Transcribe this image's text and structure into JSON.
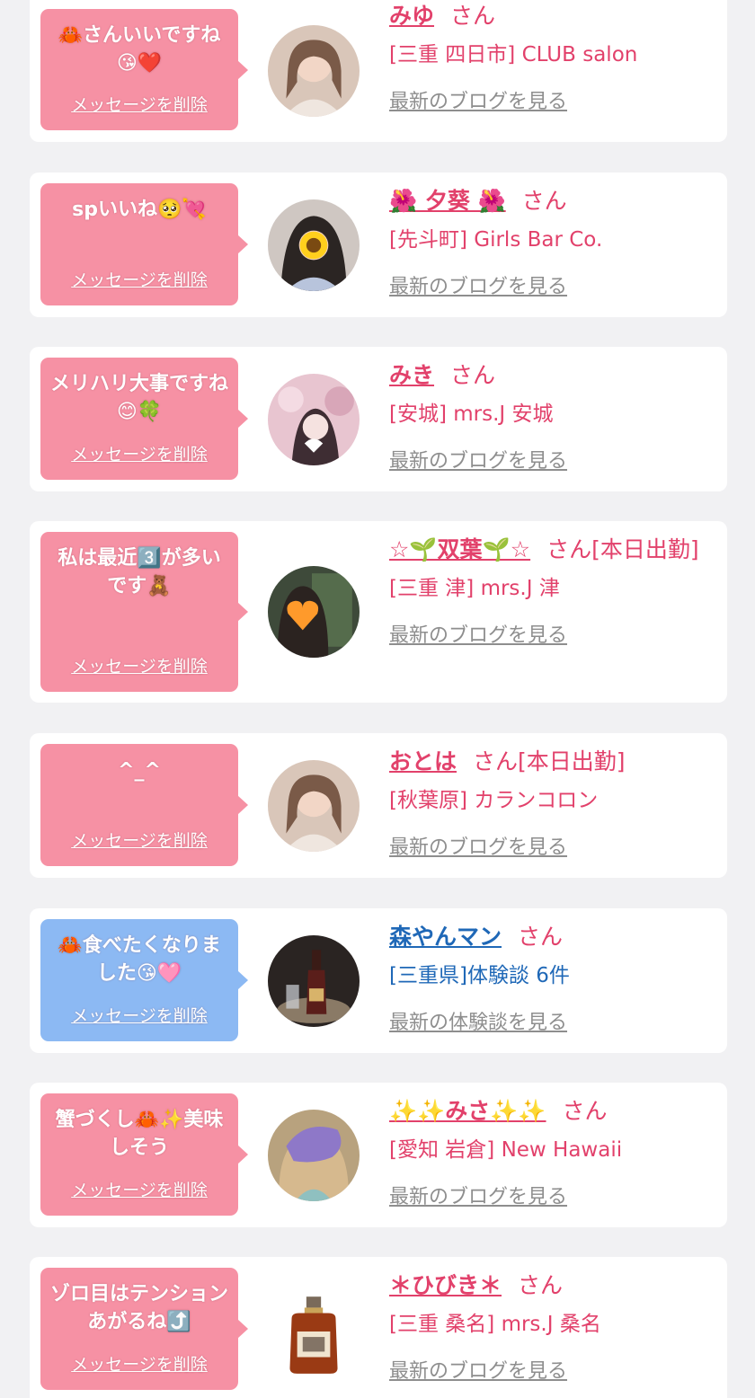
{
  "delete_label": "メッセージを削除",
  "san_suffix": "さん",
  "items": [
    {
      "message": "🦀さんいいですね😘❤️",
      "name": "みゆ",
      "badge": "",
      "shop": "[三重 四日市] CLUB salon",
      "blog_link": "最新のブログを見る",
      "bubble_color": "pink",
      "avatar": "photo"
    },
    {
      "message": "spいいね🥺💘",
      "name": "🌺 夕葵 🌺",
      "badge": "",
      "shop": "[先斗町] Girls Bar Co.",
      "blog_link": "最新のブログを見る",
      "bubble_color": "pink",
      "avatar": "sunflower-photo"
    },
    {
      "message": "メリハリ大事ですね😊🍀",
      "name": "みき",
      "badge": "",
      "shop": "[安城] mrs.J 安城",
      "blog_link": "最新のブログを見る",
      "bubble_color": "pink",
      "avatar": "flower-photo"
    },
    {
      "message": "私は最近3️⃣が多いです🧸",
      "name": "☆🌱双葉🌱☆",
      "badge": "[本日出勤]",
      "shop": "[三重 津] mrs.J 津",
      "blog_link": "最新のブログを見る",
      "bubble_color": "pink",
      "avatar": "heart-photo"
    },
    {
      "message": "^_^",
      "name": "おとは",
      "badge": "[本日出勤]",
      "shop": "[秋葉原] カランコロン",
      "blog_link": "最新のブログを見る",
      "bubble_color": "pink",
      "avatar": "photo"
    },
    {
      "message": "🦀食べたくなりました😘🩷",
      "name": "森やんマン",
      "badge": "",
      "shop": "[三重県]体験談 6件",
      "blog_link": "最新の体験談を見る",
      "bubble_color": "blue",
      "avatar": "bottle-photo"
    },
    {
      "message": "蟹づくし🦀✨美味しそう",
      "name": "✨✨みさ✨✨",
      "badge": "",
      "shop": "[愛知 岩倉] New Hawaii",
      "blog_link": "最新のブログを見る",
      "bubble_color": "pink",
      "avatar": "purple-photo"
    },
    {
      "message": "ゾロ目はテンションあがるね⤴️",
      "name": "＊ひびき＊",
      "badge": "",
      "shop": "[三重 桑名] mrs.J 桑名",
      "blog_link": "最新のブログを見る",
      "bubble_color": "pink",
      "avatar": "liquor-photo"
    }
  ]
}
